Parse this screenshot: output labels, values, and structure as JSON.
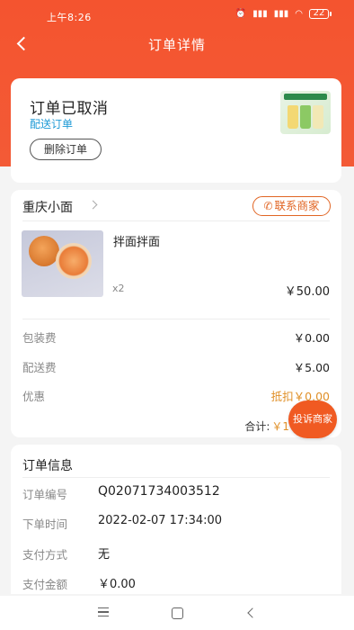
{
  "status_bar": {
    "time": "上午8:26",
    "alarm_icon": "alarm-clock-icon",
    "signal1": "signal-icon",
    "signal2": "signal-icon",
    "wifi_icon": "wifi-icon",
    "battery": "22"
  },
  "nav": {
    "title": "订单详情"
  },
  "order_status": {
    "title": "订单已取消",
    "subtitle": "配送订单",
    "delete_label": "删除订单"
  },
  "shop": {
    "name": "重庆小面",
    "contact_label": "联系商家",
    "item": {
      "name": "拌面拌面",
      "qty": "x2",
      "price": "￥50.00"
    },
    "fees": [
      {
        "label": "包装费",
        "value": "￥0.00"
      },
      {
        "label": "配送费",
        "value": "￥5.00"
      },
      {
        "label": "优惠",
        "value": "抵扣￥0.00"
      }
    ],
    "total_label": "合计:",
    "total_value": "￥1"
  },
  "complain_label": "投诉商家",
  "info": {
    "title": "订单信息",
    "rows": [
      {
        "label": "订单编号",
        "value": "Q02071734003512"
      },
      {
        "label": "下单时间",
        "value": "2022-02-07 17:34:00"
      },
      {
        "label": "支付方式",
        "value": "无"
      },
      {
        "label": "支付金额",
        "value": "￥0.00"
      }
    ]
  },
  "colors": {
    "header": "#f4542f",
    "accent_orange": "#e09029",
    "link_blue": "#1e9ad6",
    "complain": "#f05a22"
  }
}
